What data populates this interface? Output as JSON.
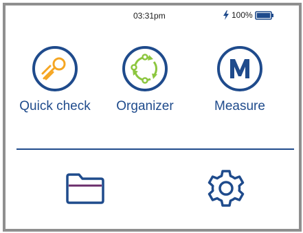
{
  "status_bar": {
    "time": "03:31pm",
    "battery_percent": "100%",
    "battery_level": 1.0,
    "charging_icon": "lightning-bolt-icon",
    "battery_icon": "battery-full-icon"
  },
  "apps": [
    {
      "label": "Quick check",
      "icon": "quick-check-icon"
    },
    {
      "label": "Organizer",
      "icon": "organizer-cycle-icon"
    },
    {
      "label": "Measure",
      "icon": "measure-m-icon"
    }
  ],
  "bottom_buttons": [
    {
      "icon": "folder-icon"
    },
    {
      "icon": "gear-icon"
    }
  ],
  "colors": {
    "primary": "#1f4b8c",
    "accent_orange": "#f5a623",
    "accent_green": "#8cc63f",
    "accent_purple": "#6b2d6b",
    "frame": "#8f8f8f"
  }
}
